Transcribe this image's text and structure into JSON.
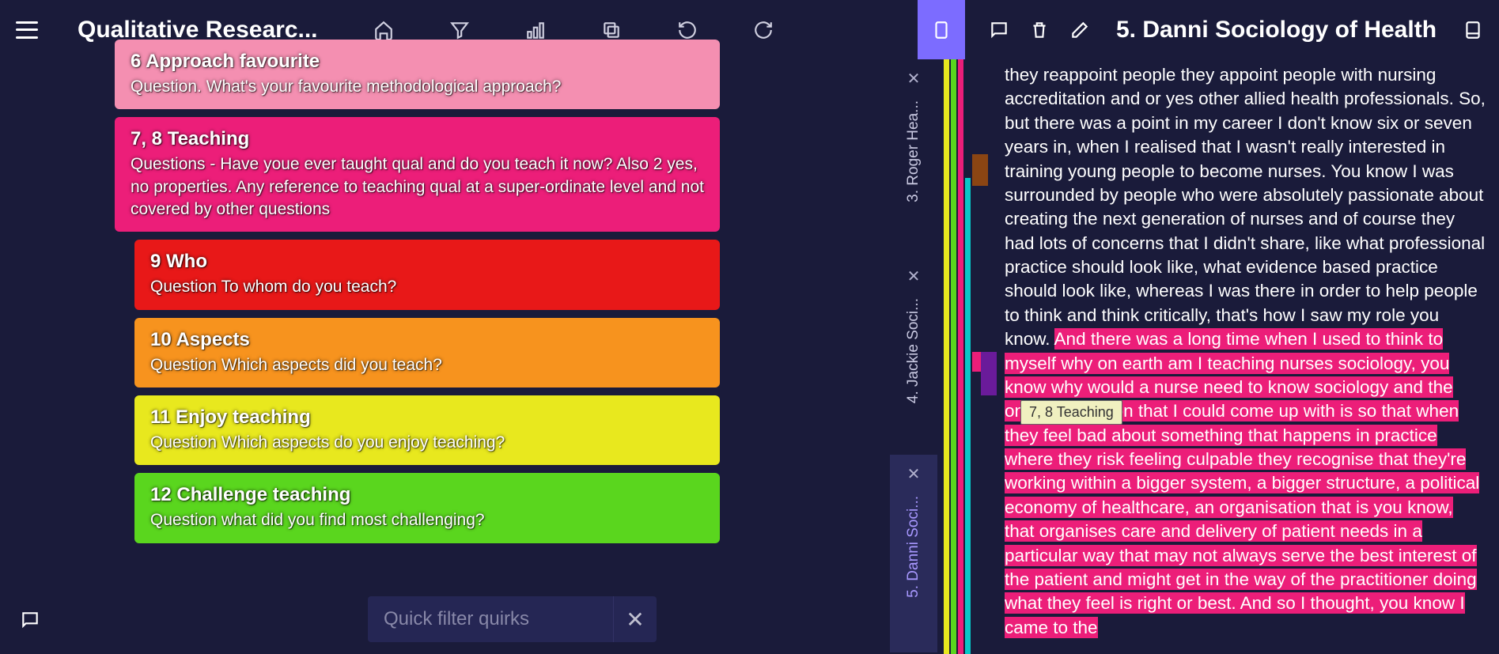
{
  "header": {
    "title_left": "Qualitative Researc...",
    "title_right": "5. Danni Sociology of Health"
  },
  "codes": [
    {
      "id": "c6",
      "title": "6 Approach favourite",
      "desc": "Question. What's your favourite methodological approach?",
      "cls": "pink-light",
      "indent": false
    },
    {
      "id": "c78",
      "title": "7, 8 Teaching",
      "desc": "Questions - Have youe ever taught qual and do you teach it now? Also 2 yes, no properties. Any reference to teaching qual at a super-ordinate level and not covered by other questions",
      "cls": "magenta",
      "indent": false
    },
    {
      "id": "c9",
      "title": "9 Who",
      "desc": "Question To whom do you teach?",
      "cls": "red",
      "indent": true
    },
    {
      "id": "c10",
      "title": "10 Aspects",
      "desc": "Question Which aspects did you teach?",
      "cls": "orange",
      "indent": true
    },
    {
      "id": "c11",
      "title": "11 Enjoy teaching",
      "desc": "Question Which aspects do you enjoy teaching?",
      "cls": "yellow",
      "indent": true
    },
    {
      "id": "c12",
      "title": "12 Challenge teaching",
      "desc": "Question what did you find most challenging?",
      "cls": "green",
      "indent": true
    }
  ],
  "filter": {
    "placeholder": "Quick filter quirks"
  },
  "vtabs": [
    {
      "label": "3. Roger Hea...",
      "active": false
    },
    {
      "label": "4. Jackie Soci...",
      "active": false
    },
    {
      "label": "5. Danni Soci...",
      "active": true
    }
  ],
  "tooltip": {
    "text": "7, 8 Teaching"
  },
  "document": {
    "pre": "they reappoint people they appoint people with nursing accreditation and or yes other allied health professionals.  So, but there was a point in my career I don't know six or seven years in, when I realised that I wasn't really interested in training young people to become nurses. You know I was surrounded by people who were absolutely passionate about creating the next generation of nurses and of course they had lots of concerns that I didn't share, like what professional practice should look like, what evidence based practice should look like, whereas I was there in order to help people to think and think critically, that's how I saw my role you know.  ",
    "hl": "And there was a long time when I used to think to myself why on earth am I teaching nurses sociology, you know why would a nurse need to know sociology and the only explanation that I could come up with is so that when they feel bad about something that happens in practice where they risk feeling culpable they recognise that they're working within a bigger system, a bigger structure, a political economy of healthcare, an organisation that is you know, that organises care and delivery of patient needs in a particular way that may not always serve the best interest of the patient and might get in the way of the practitioner doing what they feel is right or best.  And so I thought, you know I came to the"
  }
}
